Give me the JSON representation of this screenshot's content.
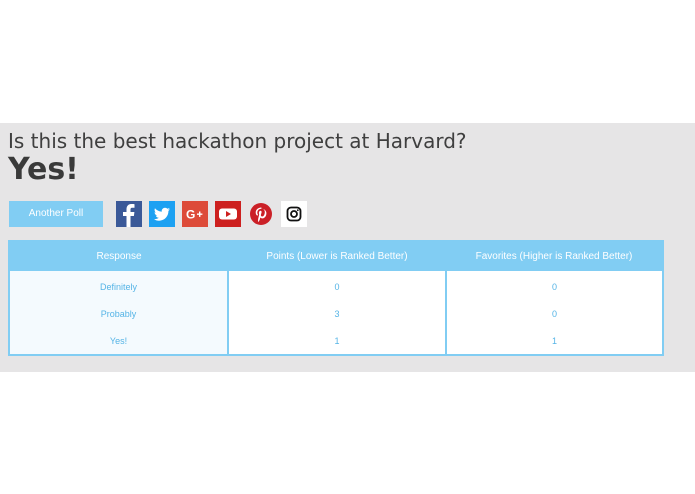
{
  "poll": {
    "question": "Is this the best hackathon project at Harvard?",
    "winner": "Yes!"
  },
  "actions": {
    "another_poll_label": "Another Poll"
  },
  "share_icons": [
    "facebook-icon",
    "twitter-icon",
    "google-plus-icon",
    "youtube-icon",
    "pinterest-icon",
    "instagram-icon"
  ],
  "table": {
    "headers": [
      "Response",
      "Points (Lower is Ranked Better)",
      "Favorites (Higher is Ranked Better)"
    ],
    "rows": [
      [
        "Definitely",
        "0",
        "0"
      ],
      [
        "Probably",
        "3",
        "0"
      ],
      [
        "Yes!",
        "1",
        "1"
      ]
    ]
  },
  "colors": {
    "accent": "#81cdf3",
    "panel_bg": "#e6e5e6",
    "cell_text": "#55b4e6"
  }
}
